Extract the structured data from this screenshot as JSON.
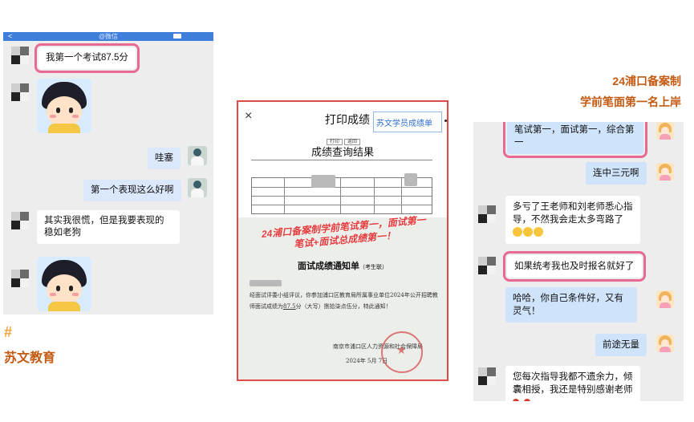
{
  "left_chat": {
    "topbar": {
      "back": "<",
      "title": "@微信"
    },
    "messages": [
      {
        "text": "我第一个考试87.5分"
      },
      {
        "text": "哇塞"
      },
      {
        "text": "第一个表现这么好啊"
      },
      {
        "text": "其实我很慌，但是我要表现的稳如老狗"
      }
    ]
  },
  "left_footer": {
    "hash": "#",
    "brand": "苏文教育"
  },
  "middle": {
    "close": "×",
    "header_title": "打印成绩",
    "tag": "苏文学员成绩单",
    "buttons": [
      "打印",
      "返回"
    ],
    "doc_title": "成绩查询结果",
    "overlay_line1": "24浦口备案制学前笔试第一，面试第一",
    "overlay_line2": "笔试+面试总成绩第一！",
    "notice_title": "面试成绩通知单",
    "notice_subtitle": "（考生联）",
    "notice_body_1": "经面试评委小组评议，你参加浦口区教育局所属事业单位2024年公开招聘教师面试成绩为",
    "notice_score": "87.5",
    "notice_body_2": "分（大写）捌拾柒点伍分，特此通知！",
    "notice_sign": "南京市浦口区人力资源和社会保障局",
    "notice_date": "2024年 5月 7日"
  },
  "right_caption": {
    "line1": "24浦口备案制",
    "line2": "学前笔面第一名上岸"
  },
  "right_chat": {
    "messages": [
      {
        "text": "笔试第一，面试第一，综合第一"
      },
      {
        "text": "连中三元啊"
      },
      {
        "text": "多亏了王老师和刘老师悉心指导，不然我会走太多弯路了"
      },
      {
        "text": "如果统考我也及时报名就好了"
      },
      {
        "text": "哈哈，你自己条件好，又有灵气！"
      },
      {
        "text": "前途无量"
      },
      {
        "text": "您每次指导我都不遗余力，倾囊相授，我还是特别感谢老师"
      }
    ]
  },
  "colors": {
    "accent_orange": "#c35a12",
    "highlight_pink": "#e86a93",
    "panel_red": "#e24a4a",
    "chat_blue": "#cfe3fb"
  }
}
